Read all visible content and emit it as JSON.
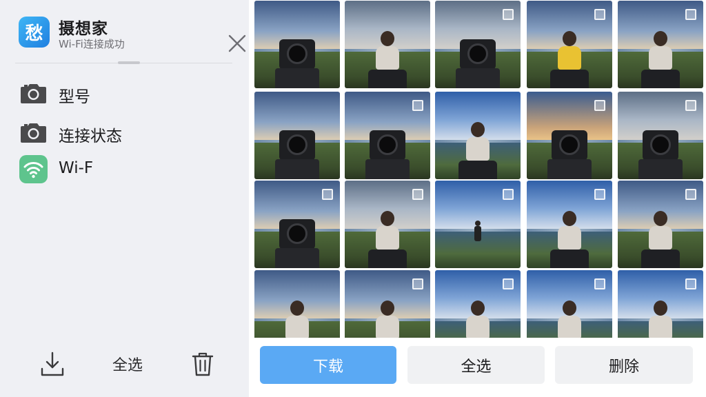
{
  "app": {
    "logo_char": "愁",
    "title": "摄想家",
    "subtitle": "Wi-Fi连接成功"
  },
  "info_rows": [
    {
      "icon": "camera-icon",
      "label": "型号"
    },
    {
      "icon": "camera-icon",
      "label": "连接状态"
    },
    {
      "icon": "wifi-icon",
      "label": "Wi-F"
    }
  ],
  "left_actions": {
    "download_icon": "download-icon",
    "select_all": "全选",
    "delete_icon": "trash-icon"
  },
  "buttons": {
    "download": "下载",
    "select_all": "全选",
    "delete": "删除"
  },
  "colors": {
    "accent": "#5aa9f4",
    "logo": "#2a93ea",
    "wifi": "#5ec48d",
    "camera_icon": "#4a4a4c"
  },
  "thumbnails": [
    {
      "subject": "camera",
      "sky": "dusk",
      "selected": false
    },
    {
      "subject": "person",
      "sky": "cloudy",
      "selected": false
    },
    {
      "subject": "camera",
      "sky": "cloudy",
      "selected": true
    },
    {
      "subject": "person-yellow",
      "sky": "dusk",
      "selected": true
    },
    {
      "subject": "person",
      "sky": "dusk",
      "selected": true
    },
    {
      "subject": "camera",
      "sky": "dusk",
      "selected": false
    },
    {
      "subject": "camera",
      "sky": "dusk",
      "selected": true
    },
    {
      "subject": "person",
      "sky": "blue",
      "selected": false
    },
    {
      "subject": "camera",
      "sky": "sunset",
      "selected": true
    },
    {
      "subject": "camera",
      "sky": "cloudy",
      "selected": true
    },
    {
      "subject": "camera",
      "sky": "dusk",
      "selected": true
    },
    {
      "subject": "person",
      "sky": "cloudy",
      "selected": true
    },
    {
      "subject": "person-far",
      "sky": "blue",
      "selected": true
    },
    {
      "subject": "person",
      "sky": "blue",
      "selected": true
    },
    {
      "subject": "person",
      "sky": "dusk",
      "selected": true
    },
    {
      "subject": "person",
      "sky": "dusk",
      "selected": false
    },
    {
      "subject": "person",
      "sky": "dusk",
      "selected": true
    },
    {
      "subject": "person",
      "sky": "blue",
      "selected": true
    },
    {
      "subject": "person",
      "sky": "blue",
      "selected": true
    },
    {
      "subject": "person",
      "sky": "blue",
      "selected": true
    }
  ]
}
